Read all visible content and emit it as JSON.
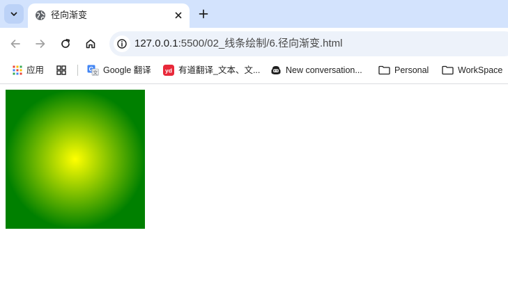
{
  "tab": {
    "title": "径向渐变"
  },
  "address_bar": {
    "host": "127.0.0.1",
    "path": ":5500/02_线条绘制/6.径向渐变.html"
  },
  "bookmarks": [
    {
      "label": "应用",
      "icon": "apps-grid-icon"
    },
    {
      "label": "",
      "icon": "grid-four-squares-icon"
    },
    {
      "label": "Google 翻译",
      "icon": "google-translate-icon"
    },
    {
      "label": "有道翻译_文本、文...",
      "icon": "youdao-icon"
    },
    {
      "label": "New conversation...",
      "icon": "copilot-icon"
    },
    {
      "label": "Personal",
      "icon": "folder-icon"
    },
    {
      "label": "WorkSpace",
      "icon": "folder-icon"
    }
  ],
  "gradient": {
    "type": "radial",
    "inner_color": "#ffff00",
    "outer_color": "#008000"
  },
  "colors": {
    "tabstrip_bg": "#d3e3fd",
    "omnibox_bg": "#edf2fa"
  }
}
